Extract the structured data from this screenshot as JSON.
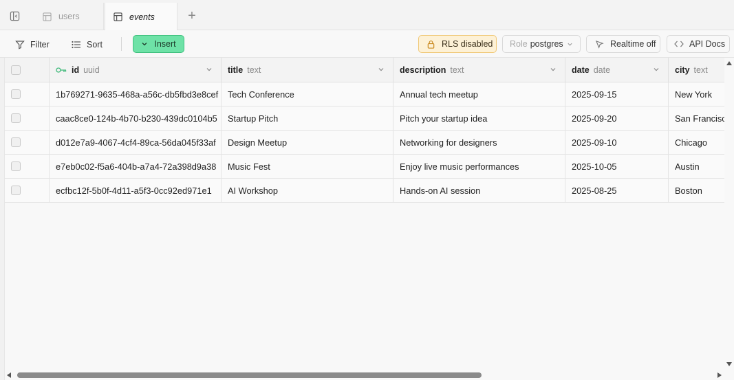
{
  "tabs": [
    {
      "label": "users",
      "active": false
    },
    {
      "label": "events",
      "active": true
    }
  ],
  "toolbar": {
    "filter_label": "Filter",
    "sort_label": "Sort",
    "insert_label": "Insert",
    "rls_label": "RLS disabled",
    "role_prefix": "Role",
    "role_value": "postgres",
    "realtime_label": "Realtime off",
    "api_docs_label": "API Docs"
  },
  "colors": {
    "insert_bg": "#6ee2a7",
    "rls_bg": "#fdf1d6",
    "key_icon": "#3fb97a"
  },
  "columns": [
    {
      "name": "id",
      "type": "uuid",
      "primary_key": true
    },
    {
      "name": "title",
      "type": "text"
    },
    {
      "name": "description",
      "type": "text"
    },
    {
      "name": "date",
      "type": "date"
    },
    {
      "name": "city",
      "type": "text"
    }
  ],
  "rows": [
    {
      "id": "1b769271-9635-468a-a56c-db5fbd3e8cef",
      "title": "Tech Conference",
      "description": "Annual tech meetup",
      "date": "2025-09-15",
      "city": "New York"
    },
    {
      "id": "caac8ce0-124b-4b70-b230-439dc0104b5",
      "title": "Startup Pitch",
      "description": "Pitch your startup idea",
      "date": "2025-09-20",
      "city": "San Francisco"
    },
    {
      "id": "d012e7a9-4067-4cf4-89ca-56da045f33af",
      "title": "Design Meetup",
      "description": "Networking for designers",
      "date": "2025-09-10",
      "city": "Chicago"
    },
    {
      "id": "e7eb0c02-f5a6-404b-a7a4-72a398d9a38",
      "title": "Music Fest",
      "description": "Enjoy live music performances",
      "date": "2025-10-05",
      "city": "Austin"
    },
    {
      "id": "ecfbc12f-5b0f-4d11-a5f3-0cc92ed971e1",
      "title": "AI Workshop",
      "description": "Hands-on AI session",
      "date": "2025-08-25",
      "city": "Boston"
    }
  ]
}
